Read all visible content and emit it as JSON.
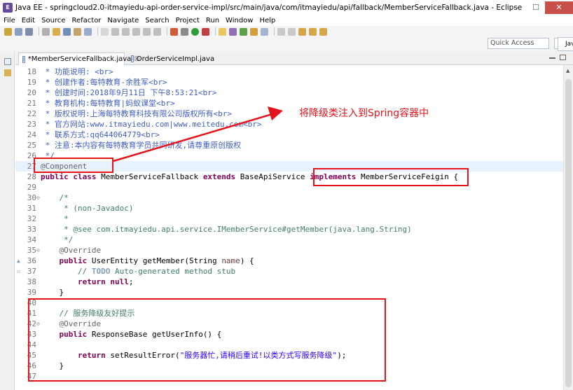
{
  "window": {
    "title": "Java EE - springcloud2.0-itmayiedu-api-order-service-impl/src/main/java/com/itmayiedu/api/fallback/MemberServiceFallback.java - Eclipse",
    "minimize_label": "—",
    "maximize_label": "☐",
    "close_label": "✕"
  },
  "menu": [
    "File",
    "Edit",
    "Source",
    "Refactor",
    "Navigate",
    "Search",
    "Project",
    "Run",
    "Window",
    "Help"
  ],
  "quick_access": {
    "placeholder": "Quick Access"
  },
  "perspective": {
    "label": "Jav"
  },
  "tabs": [
    {
      "label": "*MemberServiceFallback.java",
      "close": "☒",
      "active": true
    },
    {
      "label": "OrderServiceImpl.java",
      "active": false
    }
  ],
  "annotation": {
    "text": "将降级类注入到Spring容器中",
    "color": "#e5131a"
  },
  "code_lines": [
    {
      "n": "18",
      "text": " * 功能说明: <br>"
    },
    {
      "n": "19",
      "text": " * 创建作者:每特教育-余胜军<br>"
    },
    {
      "n": "20",
      "text": " * 创建时间:2018年9月11日 下午8:53:21<br>"
    },
    {
      "n": "21",
      "text": " * 教育机构:每特教育|蚂蚁课堂<br>"
    },
    {
      "n": "22",
      "text": " * 版权说明:上海每特教育科技有限公司版权所有<br>"
    },
    {
      "n": "23",
      "text": " * 官方网站:www.itmayiedu.com|www.meitedu.com<br>"
    },
    {
      "n": "24",
      "text": " * 联系方式:qq644064779<br>"
    },
    {
      "n": "25",
      "text": " * 注意:本内容有每特教育学员共同研发,请尊重原创版权"
    },
    {
      "n": "26",
      "text": " */"
    },
    {
      "n": "27",
      "text": "@Component"
    },
    {
      "n": "28",
      "kw1": "public class",
      "mid": " MemberServiceFallback ",
      "kw2": "extends",
      "mid2": " BaseApiService ",
      "kw3": "implements",
      "tail": " MemberServiceFeigin {"
    },
    {
      "n": "29",
      "text": ""
    },
    {
      "n": "30",
      "text": "    /*"
    },
    {
      "n": "31",
      "text": "     * (non-Javadoc)"
    },
    {
      "n": "32",
      "text": "     *"
    },
    {
      "n": "33",
      "text": "     * @see com.itmayiedu.api.service.IMemberService#getMember(java.lang.String)"
    },
    {
      "n": "34",
      "text": "     */"
    },
    {
      "n": "35",
      "text": "    @Override"
    },
    {
      "n": "36",
      "kw": "public",
      "rest": " UserEntity getMember(String ",
      "param": "name",
      "end": ") {"
    },
    {
      "n": "37",
      "c1": "        // ",
      "todo": "TODO",
      "c2": " Auto-generated method stub"
    },
    {
      "n": "38",
      "kw": "        return null",
      "end": ";"
    },
    {
      "n": "39",
      "text": "    }"
    },
    {
      "n": "40",
      "text": ""
    },
    {
      "n": "41",
      "text": "    // 服务降级友好提示"
    },
    {
      "n": "42",
      "text": "    @Override"
    },
    {
      "n": "43",
      "kw": "public",
      "rest": " ResponseBase getUserInfo() {"
    },
    {
      "n": "44",
      "text": ""
    },
    {
      "n": "45",
      "kw": "        return",
      "rest": " setResultError(",
      "str": "\"服务器忙,请稍后重试!以类方式写服务降级\"",
      "end": ");"
    },
    {
      "n": "46",
      "text": "    }"
    },
    {
      "n": "47",
      "text": ""
    }
  ]
}
